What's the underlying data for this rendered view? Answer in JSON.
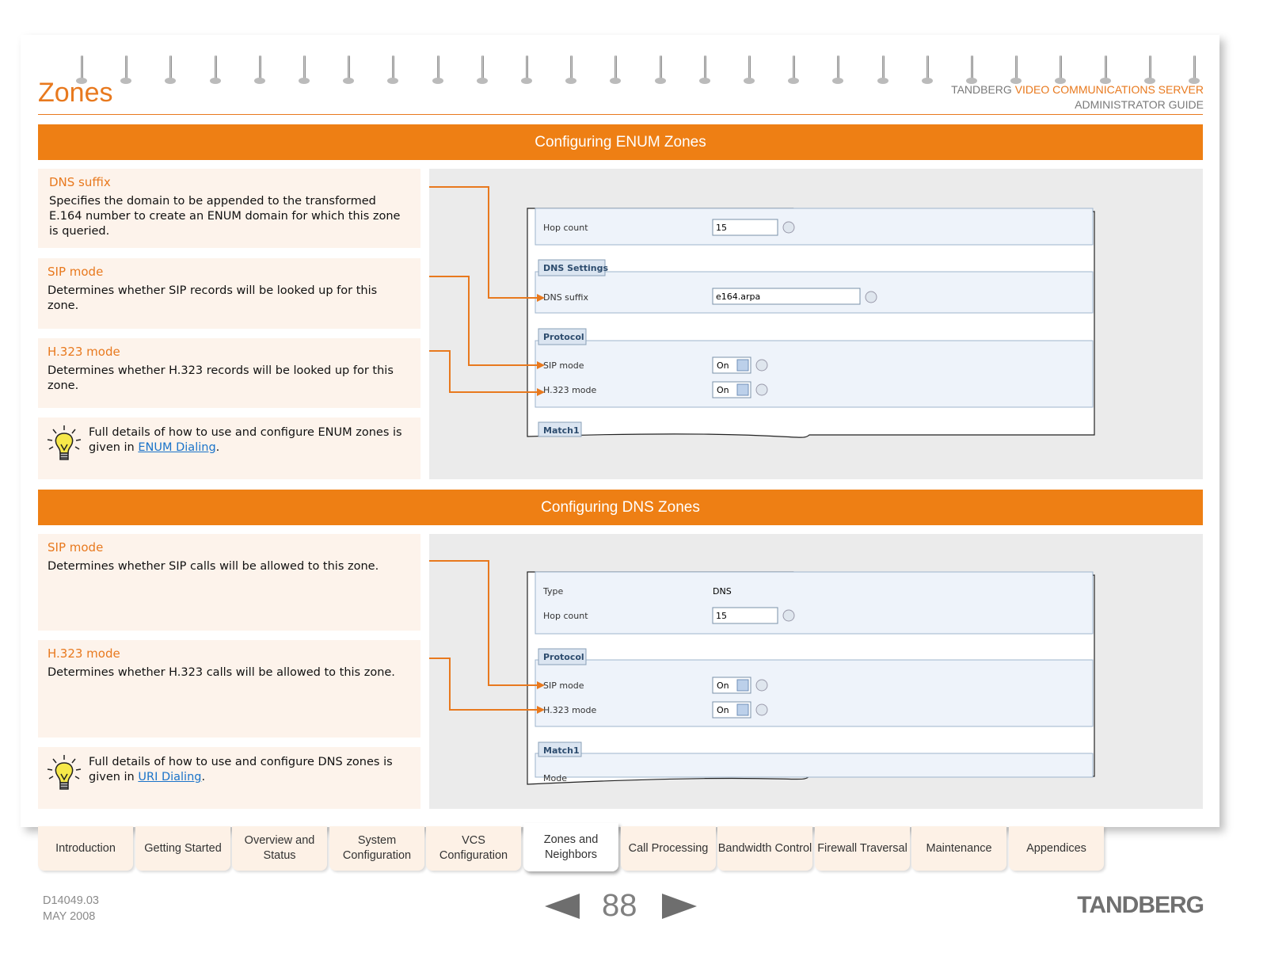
{
  "header": {
    "title": "Zones",
    "brand_prefix": "TANDBERG",
    "brand_accent": "VIDEO COMMUNICATIONS SERVER",
    "brand_sub": "ADMINISTRATOR GUIDE"
  },
  "enum_section": {
    "banner": "Configuring ENUM Zones",
    "items": [
      {
        "heading": "DNS suffix",
        "text": "Specifies the domain to be appended to the transformed E.164 number to create an ENUM domain for which this zone is queried."
      },
      {
        "heading": "SIP mode",
        "text": "Determines whether SIP records will be looked up for this zone."
      },
      {
        "heading": "H.323 mode",
        "text": "Determines whether H.323 records will be looked up for this zone."
      }
    ],
    "tip_text": "Full details of how to use and configure ENUM zones is given in ",
    "tip_link": "ENUM Dialing",
    "tip_end": ".",
    "screenshot": {
      "hop_label": "Hop count",
      "hop_value": "15",
      "dns_group": "DNS Settings",
      "dns_label": "DNS suffix",
      "dns_value": "e164.arpa",
      "protocol_group": "Protocol",
      "sip_label": "SIP mode",
      "sip_value": "On",
      "h323_label": "H.323 mode",
      "h323_value": "On",
      "match_group": "Match1"
    }
  },
  "dns_section": {
    "banner": "Configuring DNS Zones",
    "items": [
      {
        "heading": "SIP mode",
        "text": "Determines whether SIP calls will be allowed to this zone."
      },
      {
        "heading": "H.323 mode",
        "text": "Determines whether H.323 calls will be allowed to this zone."
      }
    ],
    "tip_text": "Full details of how to use and configure DNS zones is given in ",
    "tip_link": "URI Dialing",
    "tip_end": ".",
    "screenshot": {
      "type_label": "Type",
      "type_value": "DNS",
      "hop_label": "Hop count",
      "hop_value": "15",
      "protocol_group": "Protocol",
      "sip_label": "SIP mode",
      "sip_value": "On",
      "h323_label": "H.323 mode",
      "h323_value": "On",
      "match_group": "Match1",
      "mode_label": "Mode"
    }
  },
  "tabs": [
    {
      "label": "Introduction"
    },
    {
      "label": "Getting Started"
    },
    {
      "label": "Overview and Status"
    },
    {
      "label": "System Configuration"
    },
    {
      "label": "VCS Configuration"
    },
    {
      "label": "Zones and Neighbors",
      "active": true
    },
    {
      "label": "Call Processing"
    },
    {
      "label": "Bandwidth Control"
    },
    {
      "label": "Firewall Traversal"
    },
    {
      "label": "Maintenance"
    },
    {
      "label": "Appendices"
    }
  ],
  "footer": {
    "doc_id": "D14049.03",
    "date": "MAY 2008",
    "page_number": "88",
    "logo": "TANDBERG"
  },
  "colors": {
    "accent": "#ee7f14",
    "panel": "#fdf3eb",
    "link": "#1a73c9"
  }
}
